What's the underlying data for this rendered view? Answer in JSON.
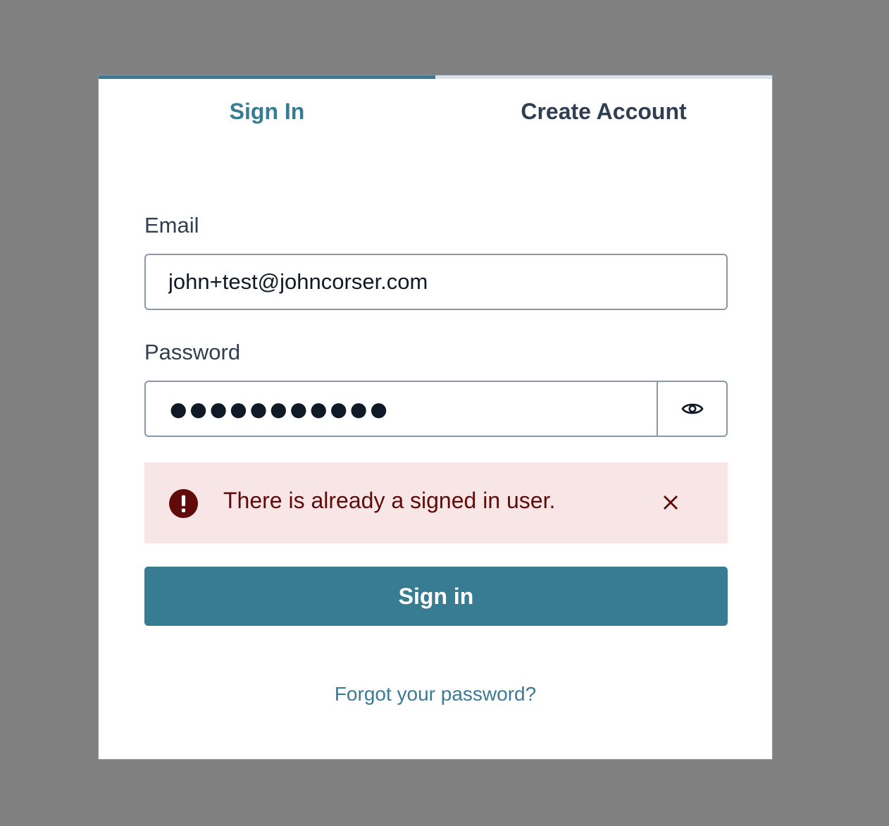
{
  "tabs": [
    {
      "label": "Sign In",
      "active": true
    },
    {
      "label": "Create Account",
      "active": false
    }
  ],
  "form": {
    "email_label": "Email",
    "email_value": "john+test@johncorser.com",
    "password_label": "Password",
    "password_value": "●●●●●●●●●●●"
  },
  "alert": {
    "message": "There is already a signed in user.",
    "icon": "error-icon",
    "close_icon": "close-icon"
  },
  "buttons": {
    "sign_in": "Sign in",
    "show_password_icon": "eye-icon"
  },
  "links": {
    "forgot_password": "Forgot your password?"
  },
  "colors": {
    "accent": "#387c93",
    "error_bg": "#f8e6e6",
    "error_text": "#600a0a",
    "background": "#808080"
  }
}
